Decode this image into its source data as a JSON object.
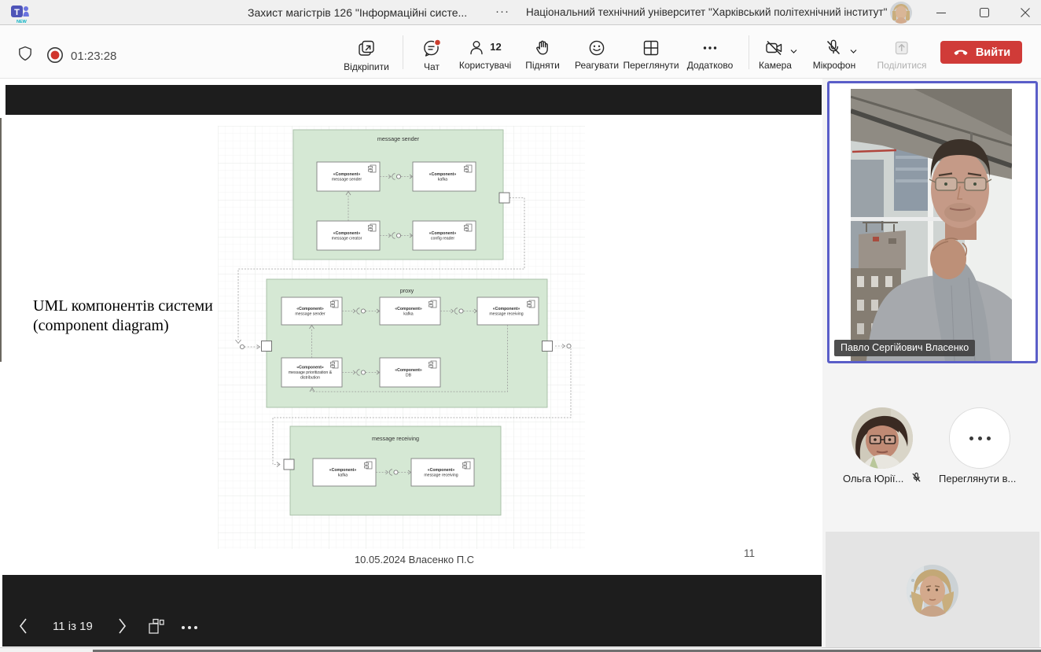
{
  "window": {
    "title": "Захист магістрів 126 \"Інформаційні систе...",
    "title_overflow": "···",
    "org": "Національний технічний університет \"Харківський політехнічний інститут\""
  },
  "toolbar": {
    "timer": "01:23:28",
    "unpin_label": "Відкріпити",
    "chat_label": "Чат",
    "users_label": "Користувачі",
    "users_count": "12",
    "raise_label": "Підняти",
    "react_label": "Реагувати",
    "view_label": "Переглянути",
    "more_label": "Додатково",
    "camera_label": "Камера",
    "mic_label": "Мікрофон",
    "share_label": "Поділитися",
    "leave_label": "Вийти"
  },
  "slide": {
    "heading_line1": "UML компонентів системи",
    "heading_line2": "(component diagram)",
    "caption": "10.05.2024 Власенко П.С",
    "page_number": "11"
  },
  "nav": {
    "position": "11 із 19"
  },
  "sidebar": {
    "speaker_name": "Павло Сергійович Власенко",
    "participant1_label": "Ольга Юрії...",
    "participant2_label": "Переглянути в..."
  },
  "diagram": {
    "containers": [
      {
        "title": "message sender",
        "components": [
          [
            "«Component»",
            "message sender"
          ],
          [
            "«Component»",
            "kafka"
          ],
          [
            "«Component»",
            "message creator"
          ],
          [
            "«Component»",
            "config reader"
          ]
        ]
      },
      {
        "title": "proxy",
        "components": [
          [
            "«Component»",
            "message sender"
          ],
          [
            "«Component»",
            "kafka"
          ],
          [
            "«Component»",
            "message receiving"
          ],
          [
            "«Component»",
            "message prioritization &",
            "distribution"
          ],
          [
            "«Component»",
            "DB"
          ]
        ]
      },
      {
        "title": "message receiving",
        "components": [
          [
            "«Component»",
            "kafka"
          ],
          [
            "«Component»",
            "message receiving"
          ]
        ]
      }
    ]
  },
  "colors": {
    "accent_purple": "#5a5ec8",
    "leave_red": "#d03b38",
    "record_red": "#d0342c",
    "badge_red": "#cc3e2e",
    "uml_green_fill": "#d5e8d4",
    "uml_green_border": "#a5bda4",
    "tile_gray": "#e4e4e4"
  }
}
